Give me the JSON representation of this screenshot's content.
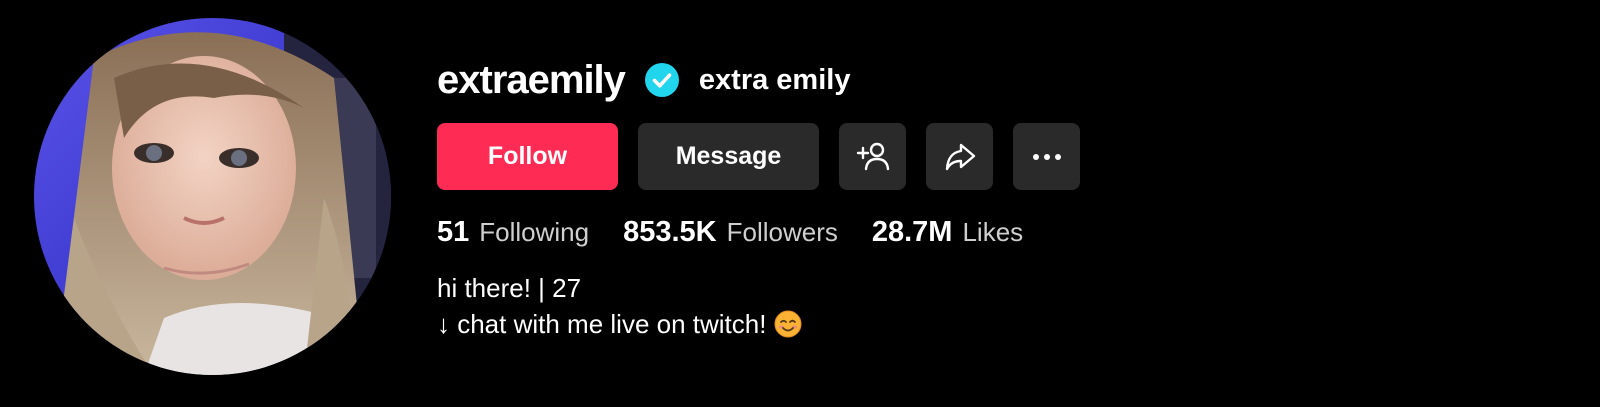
{
  "profile": {
    "username": "extraemily",
    "nickname": "extra emily",
    "verified": true,
    "avatar_icon": "profile-photo",
    "verified_icon": "verified-check-icon"
  },
  "actions": {
    "follow_label": "Follow",
    "message_label": "Message",
    "suggested_icon": "add-friend-icon",
    "share_icon": "share-icon",
    "more_icon": "more-horizontal-icon"
  },
  "stats": {
    "following_value": "51",
    "following_label": "Following",
    "followers_value": "853.5K",
    "followers_label": "Followers",
    "likes_value": "28.7M",
    "likes_label": "Likes"
  },
  "bio": {
    "line1": "hi there! | 27",
    "line2": "↓ chat with me live on twitch!",
    "emoji_icon": "smiling-face-emoji"
  },
  "colors": {
    "background": "#000000",
    "follow_button": "#fe2c55",
    "secondary_button": "#2a2a2a",
    "verified_badge": "#20d5ec",
    "secondary_text": "#cfcfcf"
  }
}
